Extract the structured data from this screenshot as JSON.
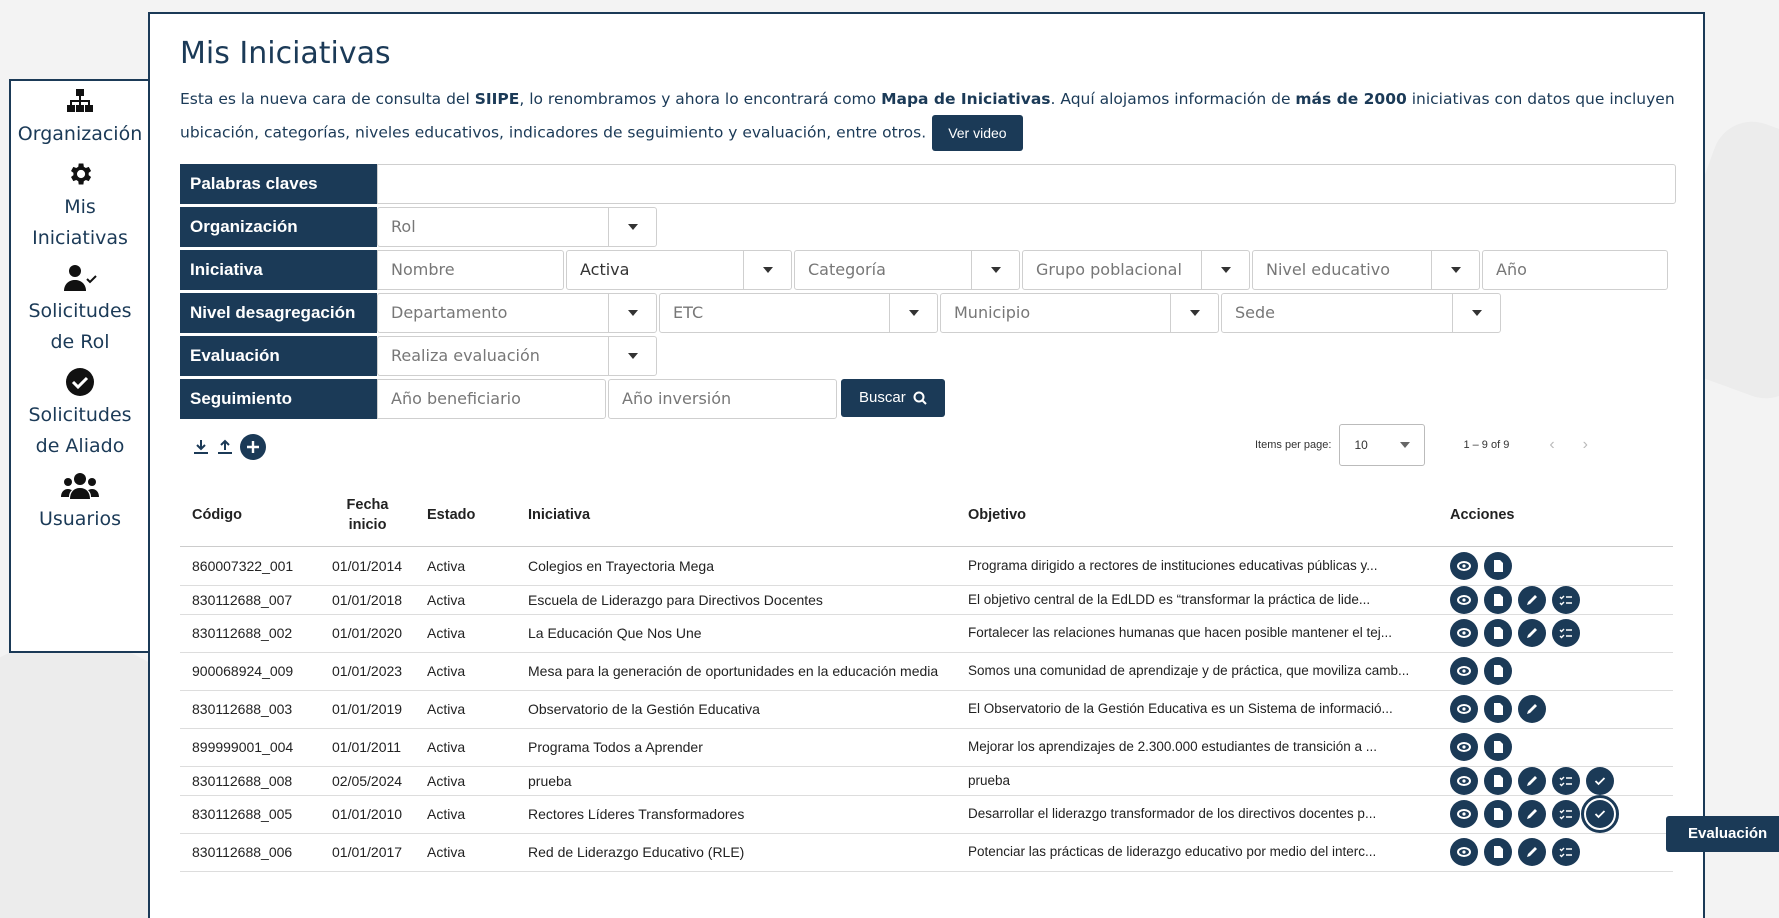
{
  "sidebar": {
    "items": [
      {
        "label": "Organización",
        "icon": "sitemap-icon"
      },
      {
        "label": "Mis\nIniciativas",
        "icon": "gear-icon"
      },
      {
        "label": "Solicitudes\nde Rol",
        "icon": "user-check-icon"
      },
      {
        "label": "Solicitudes\nde Aliado",
        "icon": "check-circle-icon"
      },
      {
        "label": "Usuarios",
        "icon": "users-icon"
      }
    ]
  },
  "page": {
    "title": "Mis Iniciativas",
    "intro_1": "Esta es la nueva cara de consulta del ",
    "intro_siipe": "SIIPE",
    "intro_2": ", lo renombramos y ahora lo encontrará como ",
    "intro_mapa": "Mapa de Iniciativas",
    "intro_3": ". Aquí alojamos información de ",
    "intro_mas": "más de 2000",
    "intro_4": " iniciativas con datos que incluyen ubicación, categorías, niveles educativos, indicadores de seguimiento y evaluación, entre otros.",
    "video_button": "Ver video"
  },
  "filters": {
    "palabras_label": "Palabras claves",
    "palabras_value": "",
    "organizacion_label": "Organización",
    "rol_placeholder": "Rol",
    "iniciativa_label": "Iniciativa",
    "nombre_placeholder": "Nombre",
    "estado_value": "Activa",
    "categoria_placeholder": "Categoría",
    "grupo_placeholder": "Grupo poblacional",
    "nivel_educativo_placeholder": "Nivel educativo",
    "anio_placeholder": "Año",
    "desagregacion_label": "Nivel desagregación",
    "departamento_placeholder": "Departamento",
    "etc_placeholder": "ETC",
    "municipio_placeholder": "Municipio",
    "sede_placeholder": "Sede",
    "evaluacion_label": "Evaluación",
    "realiza_placeholder": "Realiza evaluación",
    "seguimiento_label": "Seguimiento",
    "anio_beneficiario_placeholder": "Año beneficiario",
    "anio_inversion_placeholder": "Año inversión",
    "buscar_label": "Buscar"
  },
  "pager": {
    "items_per_page_label": "Items per page:",
    "items_per_page_value": "10",
    "range": "1 – 9 of 9"
  },
  "table": {
    "headers": [
      "Código",
      "Fecha inicio",
      "Estado",
      "Iniciativa",
      "Objetivo",
      "Acciones"
    ],
    "rows": [
      {
        "codigo": "860007322_001",
        "fecha": "01/01/2014",
        "estado": "Activa",
        "iniciativa": "Colegios en Trayectoria Mega",
        "objetivo": "Programa dirigido a rectores de instituciones educativas públicas y...",
        "acciones": 2
      },
      {
        "codigo": "830112688_007",
        "fecha": "01/01/2018",
        "estado": "Activa",
        "iniciativa": "Escuela de Liderazgo para Directivos Docentes",
        "objetivo": "El objetivo central de la EdLDD es “transformar la práctica de lide...",
        "acciones": 4
      },
      {
        "codigo": "830112688_002",
        "fecha": "01/01/2020",
        "estado": "Activa",
        "iniciativa": "La Educación Que Nos Une",
        "objetivo": "Fortalecer las relaciones humanas que hacen posible mantener el tej...",
        "acciones": 4
      },
      {
        "codigo": "900068924_009",
        "fecha": "01/01/2023",
        "estado": "Activa",
        "iniciativa": "Mesa para la generación de oportunidades en la educación media",
        "objetivo": "Somos una comunidad de aprendizaje y de práctica, que moviliza camb...",
        "acciones": 2
      },
      {
        "codigo": "830112688_003",
        "fecha": "01/01/2019",
        "estado": "Activa",
        "iniciativa": "Observatorio de la Gestión Educativa",
        "objetivo": "El Observatorio de la Gestión Educativa es un Sistema de informació...",
        "acciones": 3
      },
      {
        "codigo": "899999001_004",
        "fecha": "01/01/2011",
        "estado": "Activa",
        "iniciativa": "Programa Todos a Aprender",
        "objetivo": "Mejorar los aprendizajes de 2.300.000 estudiantes de transición a ...",
        "acciones": 2
      },
      {
        "codigo": "830112688_008",
        "fecha": "02/05/2024",
        "estado": "Activa",
        "iniciativa": "prueba",
        "objetivo": "prueba",
        "acciones": 5
      },
      {
        "codigo": "830112688_005",
        "fecha": "01/01/2010",
        "estado": "Activa",
        "iniciativa": "Rectores Líderes Transformadores",
        "objetivo": "Desarrollar el liderazgo transformador de los directivos docentes p...",
        "acciones": 5
      },
      {
        "codigo": "830112688_006",
        "fecha": "01/01/2017",
        "estado": "Activa",
        "iniciativa": "Red de Liderazgo Educativo (RLE)",
        "objetivo": "Potenciar las prácticas de liderazgo educativo por medio del interc...",
        "acciones": 4
      }
    ]
  },
  "tooltip": "Evaluación",
  "colors": {
    "primary": "#1b3a57",
    "border": "#cfcfcf"
  }
}
